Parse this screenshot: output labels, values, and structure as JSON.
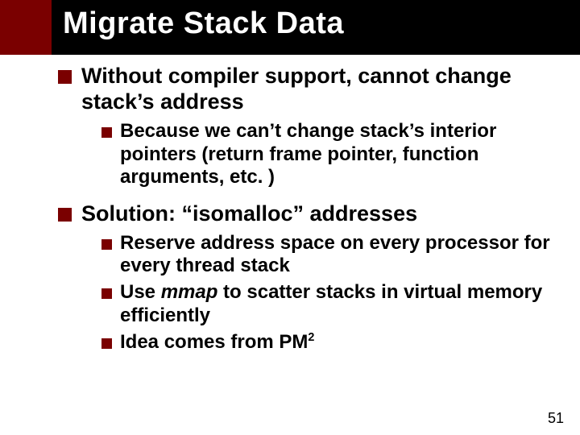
{
  "title": "Migrate Stack Data",
  "points": [
    {
      "text": "Without compiler support, cannot change stack’s address",
      "sub": [
        {
          "text": "Because we can’t change stack’s interior pointers (return frame pointer, function arguments, etc. )"
        }
      ]
    },
    {
      "text": "Solution: “isomalloc” addresses",
      "sub": [
        {
          "text": "Reserve address space on every processor for every thread stack"
        },
        {
          "prefix": "Use ",
          "italic": "mmap",
          "suffix": " to scatter stacks in virtual memory efficiently"
        },
        {
          "prefix": "Idea comes from PM",
          "super": "2"
        }
      ]
    }
  ],
  "page_number": "51"
}
